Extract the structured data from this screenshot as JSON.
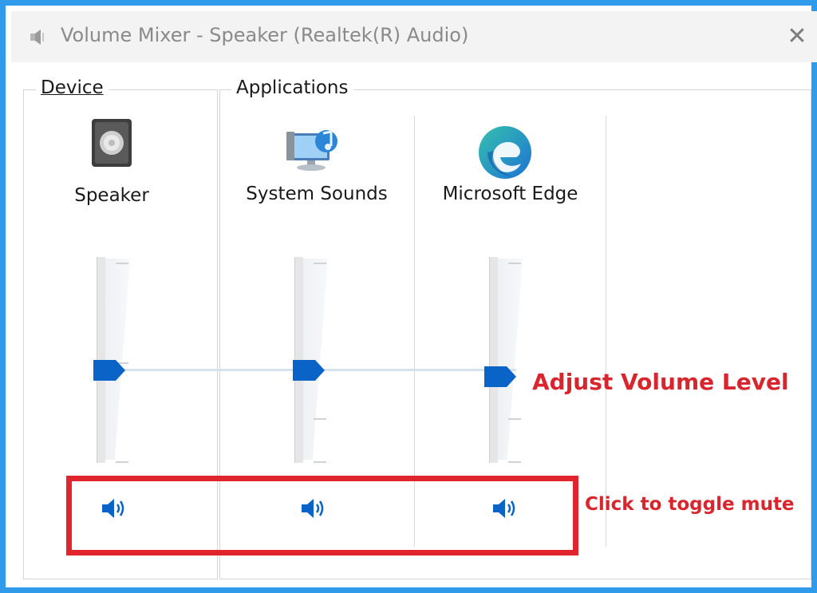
{
  "window": {
    "title": "Volume Mixer - Speaker (Realtek(R) Audio)",
    "close_glyph": "✕",
    "title_icon": "speaker-icon"
  },
  "device": {
    "group_label": "Device",
    "name": "Speaker",
    "icon": "speaker-device-icon",
    "volume_percent": 45,
    "muted": false
  },
  "applications": {
    "group_label": "Applications",
    "items": [
      {
        "name": "System Sounds",
        "icon": "system-sounds-icon",
        "volume_percent": 45,
        "muted": false
      },
      {
        "name": "Microsoft Edge",
        "icon": "edge-icon",
        "volume_percent": 45,
        "muted": false
      }
    ]
  },
  "annotations": {
    "volume": "Adjust Volume Level",
    "mute": "Click to toggle mute"
  },
  "colors": {
    "accent": "#0a64c8",
    "frame": "#2f9bea",
    "annotation": "#e0252e"
  }
}
